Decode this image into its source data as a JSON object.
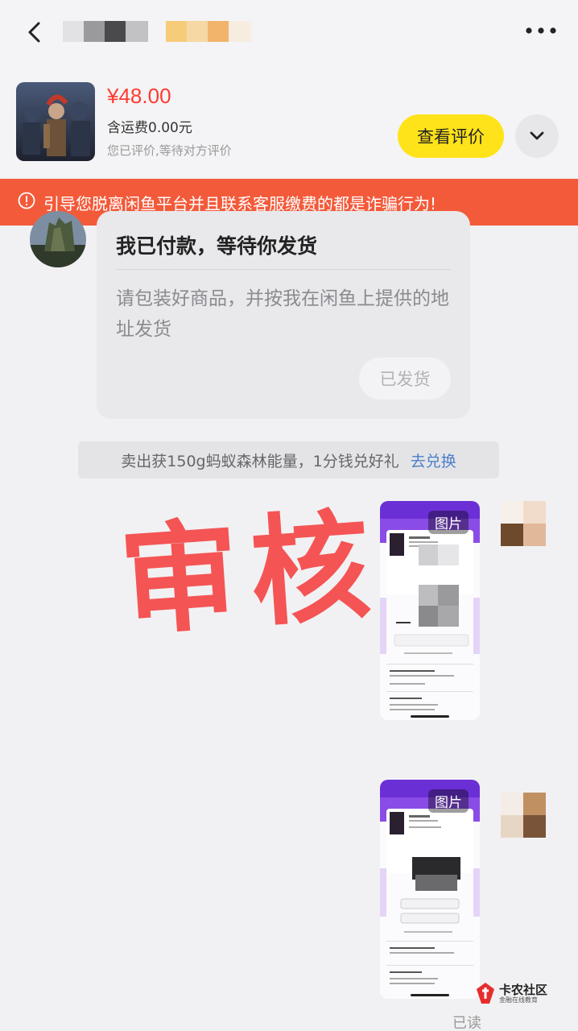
{
  "product": {
    "price": "¥48.00",
    "shipping": "含运费0.00元",
    "status_note": "您已评价,等待对方评价",
    "review_button": "查看评价"
  },
  "banner": {
    "text": "引导您脱离闲鱼平台并且联系客服缴费的都是诈骗行为!"
  },
  "message": {
    "title": "我已付款，等待你发货",
    "description": "请包装好商品，并按我在闲鱼上提供的地址发货",
    "shipped_button": "已发货"
  },
  "promo": {
    "text": "卖出获150g蚂蚁森林能量，1分钱兑好礼",
    "link": "去兑换"
  },
  "images": [
    {
      "tag": "图片"
    },
    {
      "tag": "图片"
    }
  ],
  "read_status": "已读",
  "watermark": {
    "stamp": "审核",
    "logo_main": "卡农社区",
    "logo_sub": "金融在线教育"
  },
  "colors": {
    "price": "#ff3b30",
    "banner_bg": "#f35a3a",
    "review_button_bg": "#ffe31a",
    "link": "#4a7fc8",
    "page_bg": "#f1f1f3"
  }
}
